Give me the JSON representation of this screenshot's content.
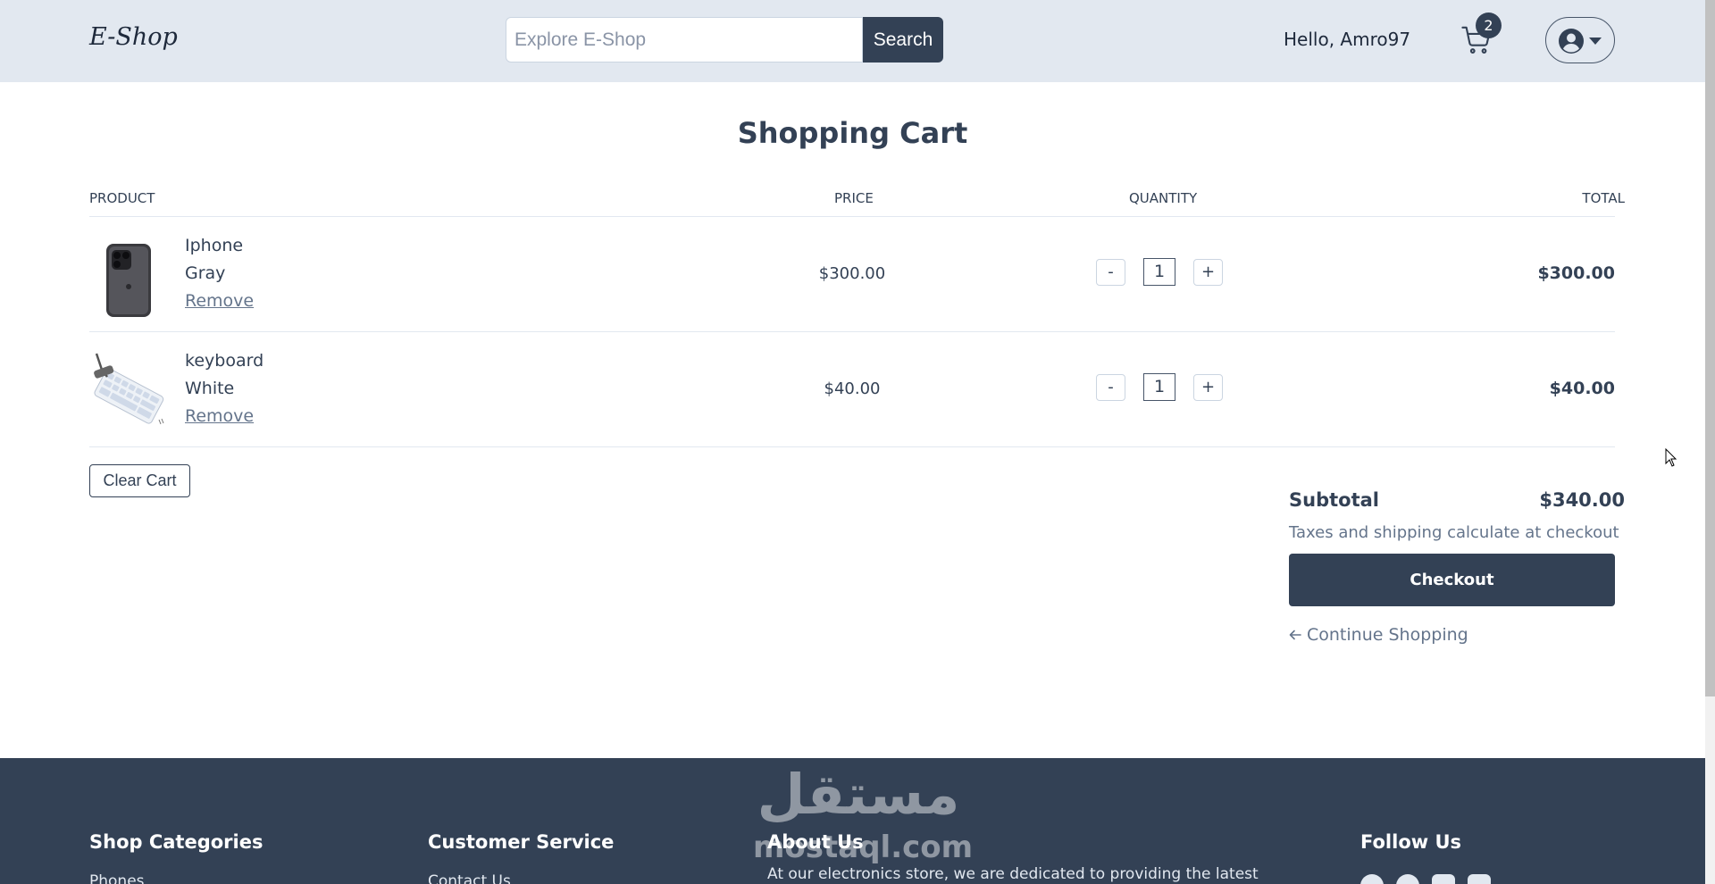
{
  "header": {
    "logo": "E-Shop",
    "search": {
      "placeholder": "Explore E-Shop",
      "button_label": "Search"
    },
    "greeting": "Hello, Amro97",
    "cart_count": "2"
  },
  "cart": {
    "title": "Shopping Cart",
    "columns": [
      "PRODUCT",
      "PRICE",
      "QUANTITY",
      "TOTAL"
    ],
    "items": [
      {
        "name": "Iphone",
        "variant": "Gray",
        "remove_label": "Remove",
        "price": "$300.00",
        "quantity": "1",
        "total": "$300.00",
        "minus_label": "-",
        "plus_label": "+"
      },
      {
        "name": "keyboard",
        "variant": "White",
        "remove_label": "Remove",
        "price": "$40.00",
        "quantity": "1",
        "total": "$40.00",
        "minus_label": "-",
        "plus_label": "+"
      }
    ],
    "clear_label": "Clear Cart",
    "summary": {
      "subtotal_label": "Subtotal",
      "subtotal_value": "$340.00",
      "tax_note": "Taxes and shipping calculate at checkout",
      "checkout_label": "Checkout",
      "continue_label": "Continue Shopping"
    }
  },
  "footer": {
    "watermark_arabic": "مستقل",
    "watermark_latin": "mostaql.com",
    "columns": [
      {
        "heading": "Shop Categories",
        "first_link": "Phones"
      },
      {
        "heading": "Customer Service",
        "first_link": "Contact Us"
      },
      {
        "heading": "About Us",
        "text": "At our electronics store, we are dedicated to providing the latest"
      },
      {
        "heading": "Follow Us"
      }
    ]
  },
  "colors": {
    "header_bg": "#e2e8f0",
    "primary": "#334155",
    "muted_text": "#64748b",
    "footer_bg": "#334155"
  },
  "icons": [
    "cart-icon",
    "user-circle-icon",
    "caret-down-icon",
    "arrow-left-icon",
    "facebook-icon",
    "globe-icon",
    "instagram-icon",
    "youtube-icon"
  ]
}
